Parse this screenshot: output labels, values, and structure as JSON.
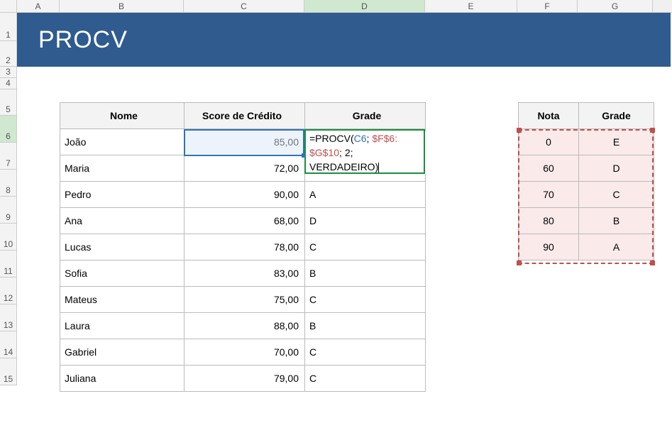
{
  "columns": [
    "A",
    "B",
    "C",
    "D",
    "E",
    "F",
    "G"
  ],
  "active_column": "D",
  "rows": [
    1,
    2,
    3,
    4,
    5,
    6,
    7,
    8,
    9,
    10,
    11,
    12,
    13,
    14,
    15
  ],
  "active_row": 6,
  "banner_title": "PROCV",
  "main_headers": {
    "name": "Nome",
    "score": "Score de Crédito",
    "grade": "Grade"
  },
  "main_rows": [
    {
      "name": "João",
      "score": "85,00",
      "grade": ""
    },
    {
      "name": "Maria",
      "score": "72,00",
      "grade": ""
    },
    {
      "name": "Pedro",
      "score": "90,00",
      "grade": "A"
    },
    {
      "name": "Ana",
      "score": "68,00",
      "grade": "D"
    },
    {
      "name": "Lucas",
      "score": "78,00",
      "grade": "C"
    },
    {
      "name": "Sofia",
      "score": "83,00",
      "grade": "B"
    },
    {
      "name": "Mateus",
      "score": "75,00",
      "grade": "C"
    },
    {
      "name": "Laura",
      "score": "88,00",
      "grade": "B"
    },
    {
      "name": "Gabriel",
      "score": "70,00",
      "grade": "C"
    },
    {
      "name": "Juliana",
      "score": "79,00",
      "grade": "C"
    }
  ],
  "lookup_headers": {
    "nota": "Nota",
    "grade": "Grade"
  },
  "lookup_rows": [
    {
      "nota": "0",
      "grade": "E"
    },
    {
      "nota": "60",
      "grade": "D"
    },
    {
      "nota": "70",
      "grade": "C"
    },
    {
      "nota": "80",
      "grade": "B"
    },
    {
      "nota": "90",
      "grade": "A"
    }
  ],
  "formula": {
    "part1": "=PROCV(",
    "ref1": "C6",
    "sep1": "; ",
    "ref2a": "$F$6",
    "colon": ":",
    "ref2b": "$G$10",
    "sep2": "; 2; ",
    "part3": "VERDADEIRO)"
  },
  "chart_data": {
    "type": "table",
    "tables": [
      {
        "title": "PROCV example data",
        "columns": [
          "Nome",
          "Score de Crédito",
          "Grade"
        ],
        "rows": [
          [
            "João",
            85.0,
            null
          ],
          [
            "Maria",
            72.0,
            null
          ],
          [
            "Pedro",
            90.0,
            "A"
          ],
          [
            "Ana",
            68.0,
            "D"
          ],
          [
            "Lucas",
            78.0,
            "C"
          ],
          [
            "Sofia",
            83.0,
            "B"
          ],
          [
            "Mateus",
            75.0,
            "C"
          ],
          [
            "Laura",
            88.0,
            "B"
          ],
          [
            "Gabriel",
            70.0,
            "C"
          ],
          [
            "Juliana",
            79.0,
            "C"
          ]
        ]
      },
      {
        "title": "Lookup table",
        "columns": [
          "Nota",
          "Grade"
        ],
        "rows": [
          [
            0,
            "E"
          ],
          [
            60,
            "D"
          ],
          [
            70,
            "C"
          ],
          [
            80,
            "B"
          ],
          [
            90,
            "A"
          ]
        ]
      }
    ],
    "formula_in_cell": "=PROCV(C6; $F$6:$G$10; 2; VERDADEIRO)"
  }
}
